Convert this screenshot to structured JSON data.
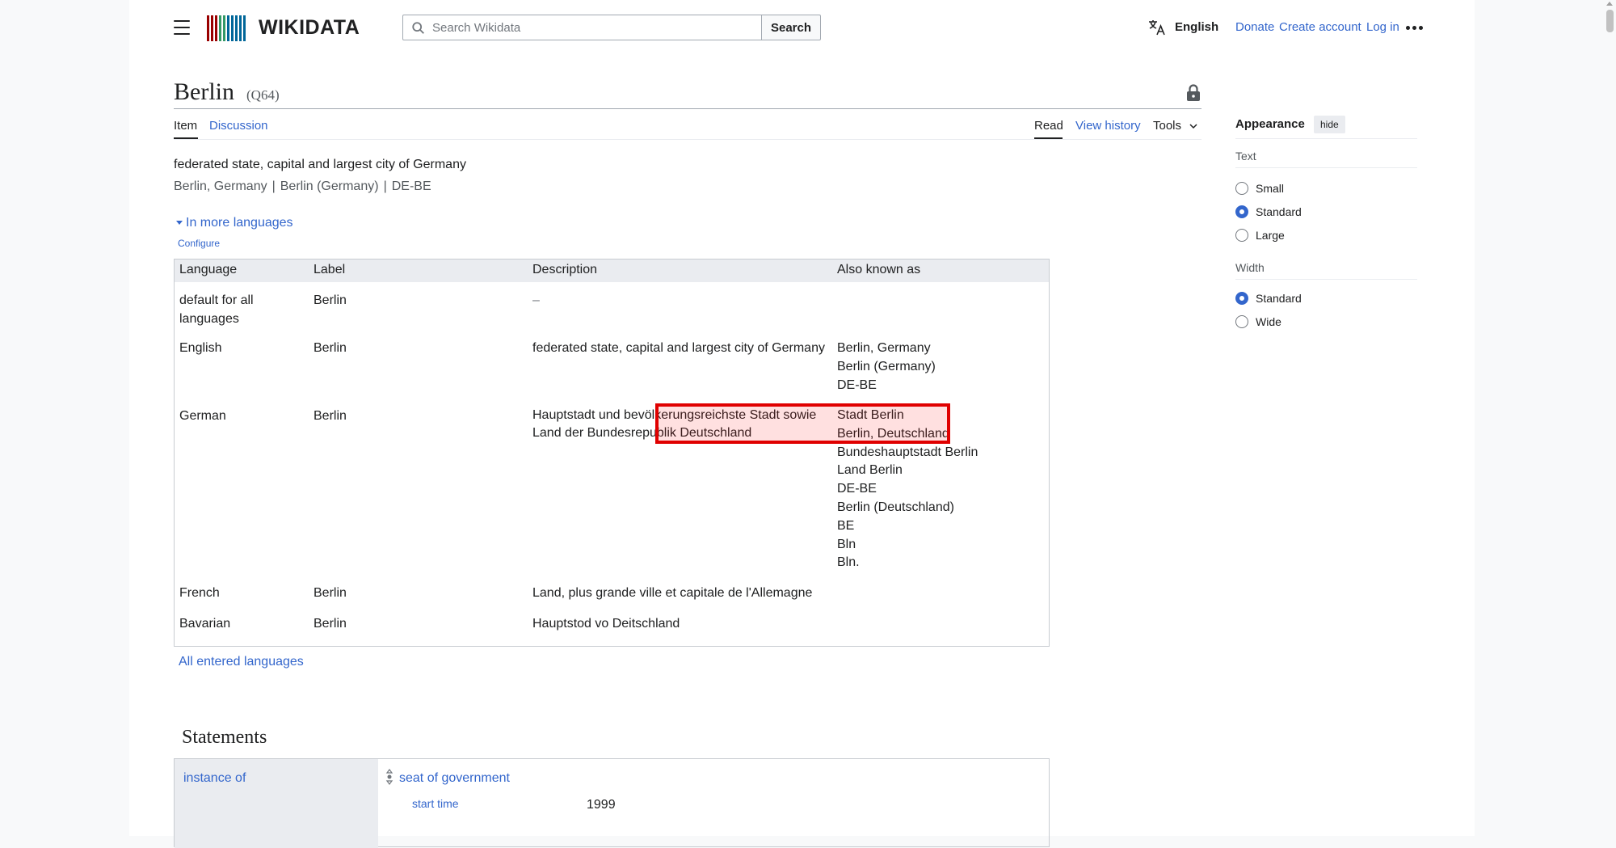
{
  "header": {
    "logo_text": "WIKIDATA",
    "logo_colors": [
      "#990000",
      "#339966",
      "#006699"
    ],
    "search_placeholder": "Search Wikidata",
    "search_button": "Search",
    "language": "English",
    "links": {
      "donate": "Donate",
      "create_account": "Create account",
      "log_in": "Log in"
    }
  },
  "item": {
    "title": "Berlin",
    "qid": "(Q64)",
    "tabs": {
      "item": "Item",
      "discussion": "Discussion"
    },
    "actions": {
      "read": "Read",
      "view_history": "View history",
      "tools": "Tools"
    },
    "description": "federated state, capital and largest city of Germany",
    "aliases": [
      "Berlin, Germany",
      "Berlin (Germany)",
      "DE-BE"
    ],
    "in_more_languages": "In more languages",
    "configure": "Configure",
    "all_entered_languages": "All entered languages"
  },
  "lang_table": {
    "headers": [
      "Language",
      "Label",
      "Description",
      "Also known as"
    ],
    "rows": [
      {
        "language": "default for all languages",
        "label": "Berlin",
        "description": "–",
        "aliases": []
      },
      {
        "language": "English",
        "label": "Berlin",
        "description": "federated state, capital and largest city of Germany",
        "aliases": [
          "Berlin, Germany",
          "Berlin (Germany)",
          "DE-BE"
        ]
      },
      {
        "language": "German",
        "label": "Berlin",
        "description": "Hauptstadt und bevölkerungsreichste Stadt sowie Land der Bundesrepublik Deutschland",
        "aliases": [
          "Stadt Berlin",
          "Berlin, Deutschland",
          "Bundeshauptstadt Berlin",
          "Land Berlin",
          "DE-BE",
          "Berlin (Deutschland)",
          "BE",
          "Bln",
          "Bln."
        ]
      },
      {
        "language": "French",
        "label": "Berlin",
        "description": "Land, plus grande ville et capitale de l'Allemagne",
        "aliases": []
      },
      {
        "language": "Bavarian",
        "label": "Berlin",
        "description": "Hauptstod vo Deitschland",
        "aliases": []
      }
    ]
  },
  "statements": {
    "heading": "Statements",
    "property": "instance of",
    "value": "seat of government",
    "qualifier_property": "start time",
    "qualifier_value": "1999"
  },
  "appearance": {
    "title": "Appearance",
    "hide": "hide",
    "text_label": "Text",
    "text_options": [
      "Small",
      "Standard",
      "Large"
    ],
    "text_selected": "Standard",
    "width_label": "Width",
    "width_options": [
      "Standard",
      "Wide"
    ],
    "width_selected": "Standard"
  },
  "colors": {
    "link": "#3366cc",
    "highlight": "#e00000",
    "table_header": "#eaecf0"
  }
}
